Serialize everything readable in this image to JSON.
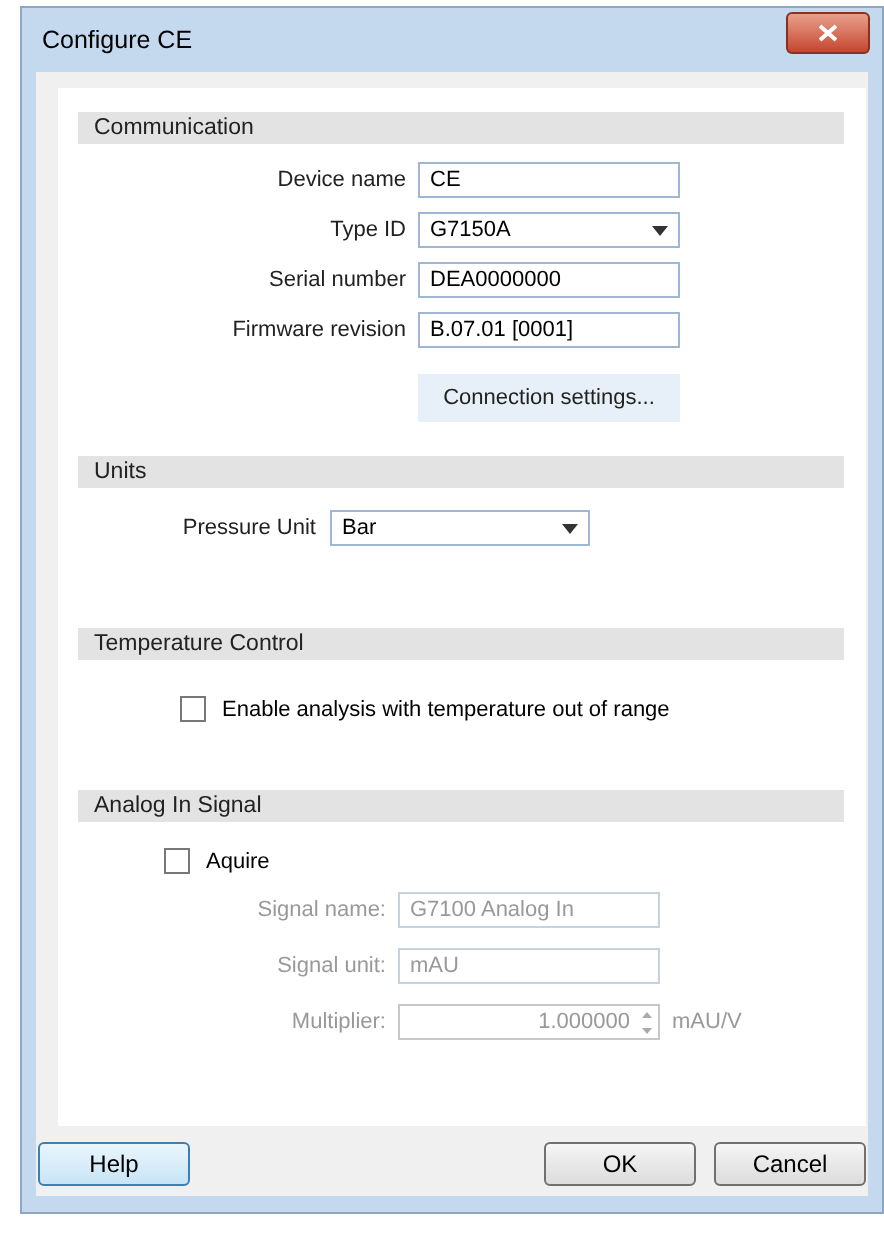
{
  "window": {
    "title": "Configure CE"
  },
  "communication": {
    "header": "Communication",
    "fields": [
      {
        "kind": "text",
        "label": "Device name",
        "value": "CE",
        "disabled": false
      },
      {
        "kind": "select",
        "label": "Type ID",
        "value": "G7150A",
        "disabled": false
      },
      {
        "kind": "text",
        "label": "Serial number",
        "value": "DEA0000000",
        "disabled": false
      },
      {
        "kind": "text",
        "label": "Firmware revision",
        "value": "B.07.01 [0001]",
        "disabled": false
      }
    ],
    "button": "Connection settings..."
  },
  "units": {
    "header": "Units",
    "fields": [
      {
        "kind": "select",
        "label": "Pressure Unit",
        "value": "Bar",
        "disabled": false
      }
    ]
  },
  "temperature_control": {
    "header": "Temperature Control",
    "checkbox": {
      "label": "Enable analysis with temperature out of range",
      "checked": false
    }
  },
  "analog_in_signal": {
    "header": "Analog In Signal",
    "checkbox": {
      "label": "Aquire",
      "checked": false
    },
    "fields": [
      {
        "kind": "text",
        "label": "Signal name:",
        "value": "G7100 Analog In",
        "disabled": true
      },
      {
        "kind": "text",
        "label": "Signal unit:",
        "value": "mAU",
        "disabled": true
      },
      {
        "kind": "spinner",
        "label": "Multiplier:",
        "value": "1.000000",
        "suffix": "mAU/V",
        "disabled": true
      }
    ]
  },
  "buttons": [
    "Help",
    "OK",
    "Cancel"
  ]
}
